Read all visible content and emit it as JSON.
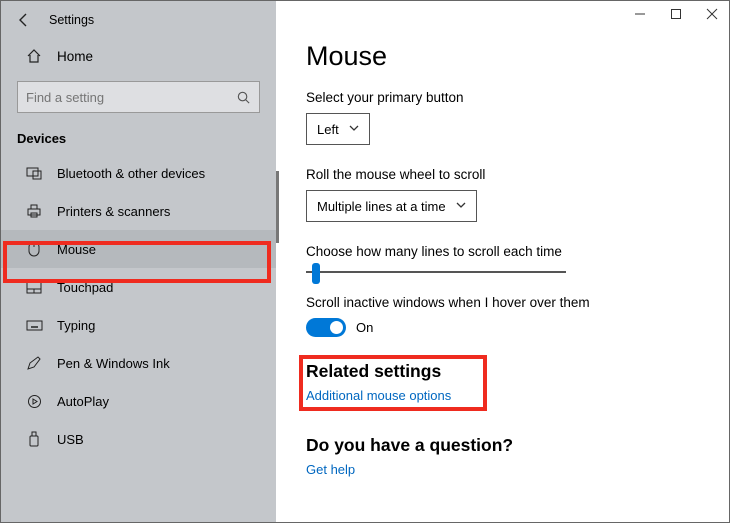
{
  "titlebar": {
    "app_name": "Settings"
  },
  "sidebar": {
    "home": "Home",
    "search_placeholder": "Find a setting",
    "section": "Devices",
    "items": [
      {
        "label": "Bluetooth & other devices"
      },
      {
        "label": "Printers & scanners"
      },
      {
        "label": "Mouse"
      },
      {
        "label": "Touchpad"
      },
      {
        "label": "Typing"
      },
      {
        "label": "Pen & Windows Ink"
      },
      {
        "label": "AutoPlay"
      },
      {
        "label": "USB"
      }
    ]
  },
  "main": {
    "heading": "Mouse",
    "primary_button": {
      "label": "Select your primary button",
      "value": "Left"
    },
    "wheel_scroll": {
      "label": "Roll the mouse wheel to scroll",
      "value": "Multiple lines at a time"
    },
    "lines": {
      "label": "Choose how many lines to scroll each time"
    },
    "inactive": {
      "label": "Scroll inactive windows when I hover over them",
      "value": "On"
    },
    "related": {
      "heading": "Related settings",
      "link": "Additional mouse options"
    },
    "question": {
      "heading": "Do you have a question?",
      "link": "Get help"
    }
  }
}
